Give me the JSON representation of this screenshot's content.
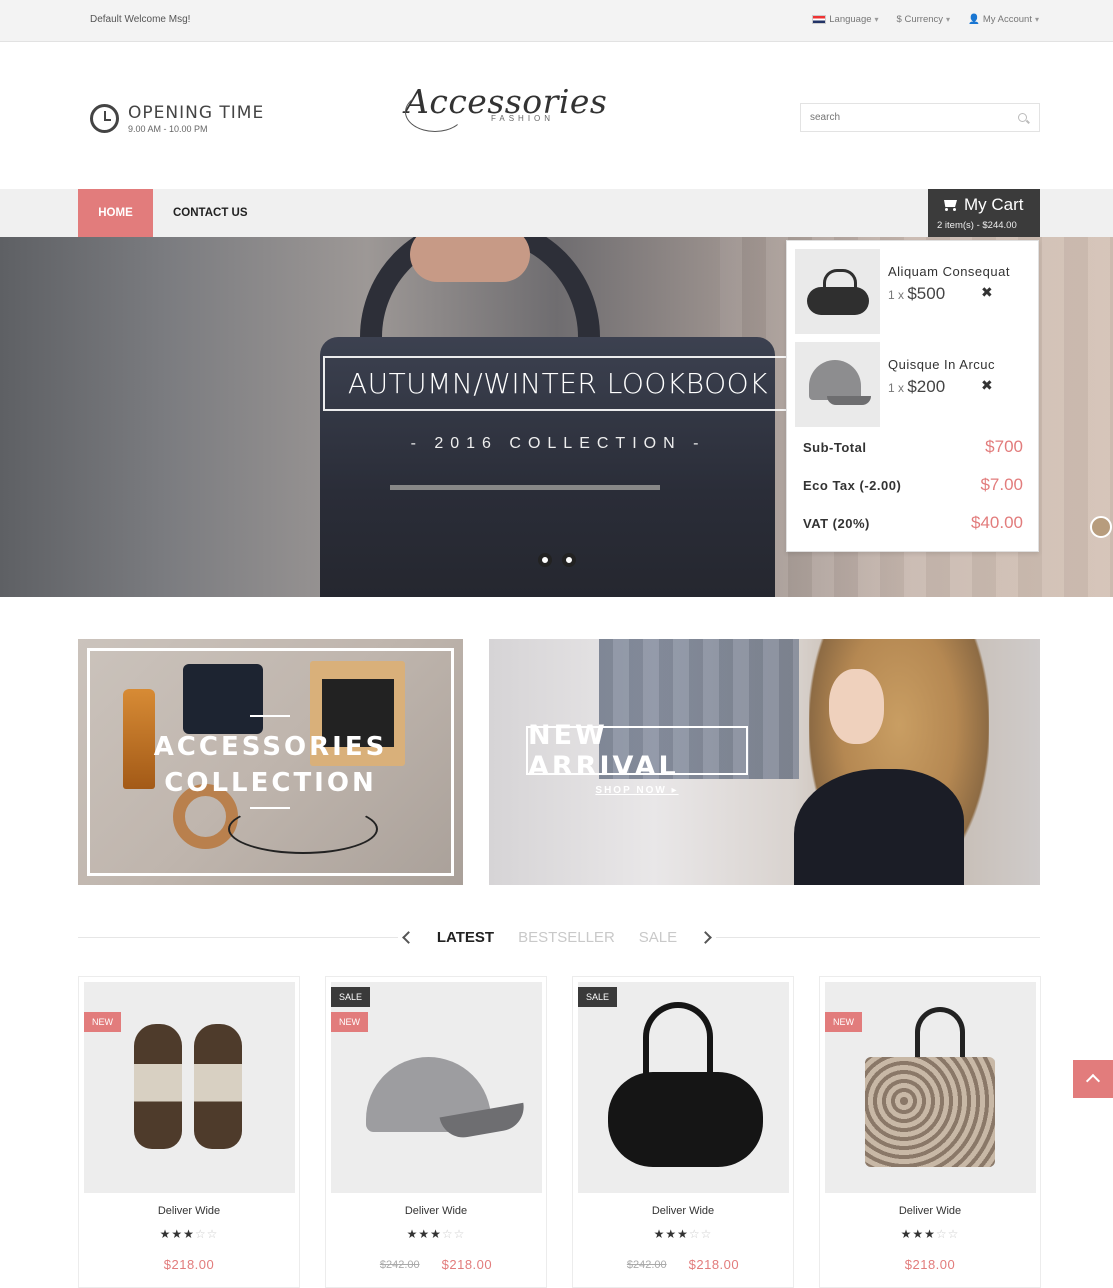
{
  "topbar": {
    "welcome": "Default Welcome Msg!",
    "language": "Language",
    "currency": "$ Currency",
    "account": "My Account"
  },
  "header": {
    "opening_title": "OPENING TIME",
    "opening_hours": "9.00 AM - 10.00 PM",
    "logo_script": "Accessories",
    "logo_sub": "FASHION",
    "search_placeholder": "search"
  },
  "nav": {
    "home": "HOME",
    "contact": "CONTACT US"
  },
  "cart": {
    "title": "My Cart",
    "summary": "2 item(s) - $244.00",
    "items": [
      {
        "name": "Aliquam Consequat",
        "qty": "1 x ",
        "price": "$500"
      },
      {
        "name": "Quisque In Arcuc",
        "qty": "1 x ",
        "price": "$200"
      }
    ],
    "rows": [
      {
        "label": "Sub-Total",
        "value": "$700"
      },
      {
        "label": "Eco Tax (-2.00)",
        "value": "$7.00"
      },
      {
        "label": "VAT (20%)",
        "value": "$40.00"
      }
    ],
    "remove_glyph": "✖"
  },
  "slider": {
    "title": "AUTUMN/WINTER LOOKBOOK",
    "subtitle": "- 2016 COLLECTION -"
  },
  "banners": {
    "left_line1": "ACCESSORIES",
    "left_line2": "COLLECTION",
    "right_title": "NEW ARRIVAL",
    "right_link": "SHOP NOW ▸"
  },
  "tabs": {
    "items": [
      "LATEST",
      "BESTSELLER",
      "SALE"
    ],
    "active": "LATEST"
  },
  "products": [
    {
      "name": "Deliver Wide",
      "rating": 3,
      "max_rating": 5,
      "old_price": "",
      "price": "$218.00",
      "badges": [
        "NEW"
      ]
    },
    {
      "name": "Deliver Wide",
      "rating": 3,
      "max_rating": 5,
      "old_price": "$242.00",
      "price": "$218.00",
      "badges": [
        "SALE",
        "NEW"
      ]
    },
    {
      "name": "Deliver Wide",
      "rating": 3,
      "max_rating": 5,
      "old_price": "$242.00",
      "price": "$218.00",
      "badges": [
        "SALE"
      ]
    },
    {
      "name": "Deliver Wide",
      "rating": 3,
      "max_rating": 5,
      "old_price": "",
      "price": "$218.00",
      "badges": [
        "NEW"
      ]
    }
  ],
  "colors": {
    "accent": "#e27c7c",
    "dark": "#3b3b3b",
    "nav_bg": "#f0f0f0"
  }
}
